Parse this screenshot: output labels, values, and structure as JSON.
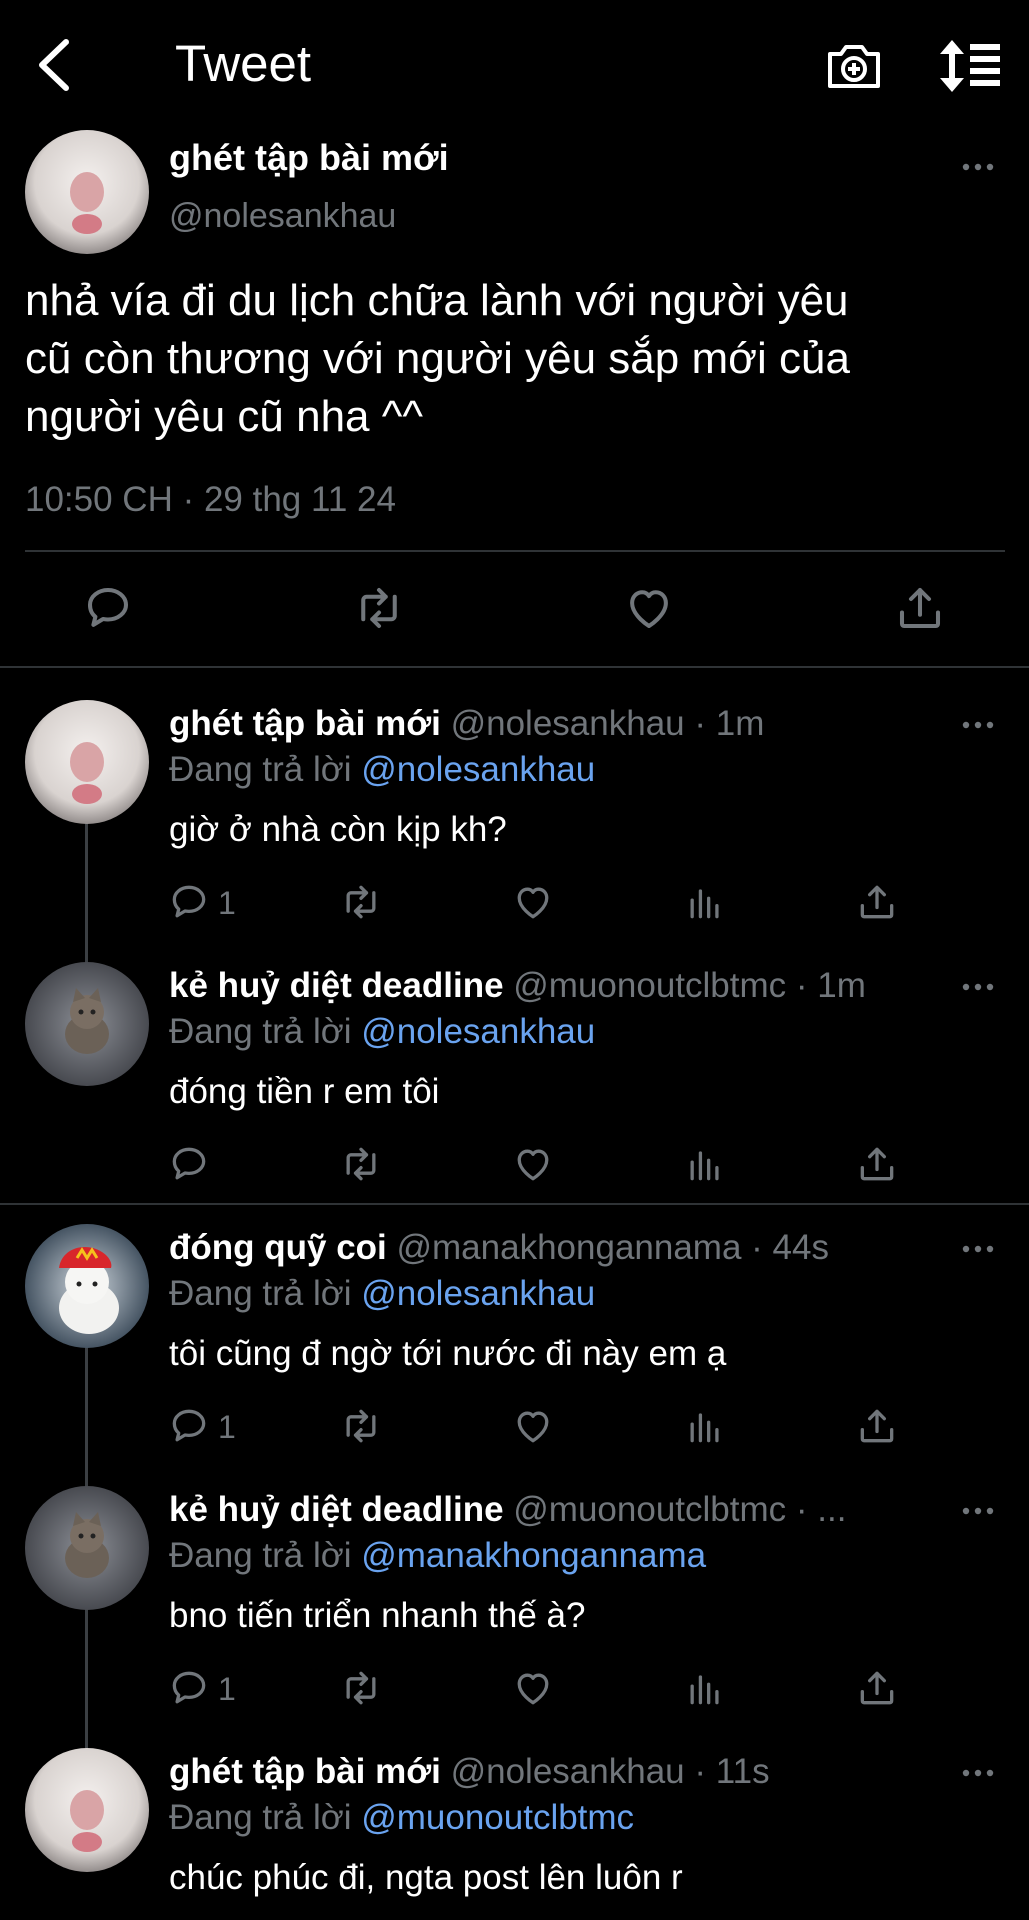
{
  "header": {
    "title": "Tweet",
    "icons": [
      "back-arrow-icon",
      "camera-plus-icon",
      "sort-icon"
    ]
  },
  "main_tweet": {
    "author_name": "ghét tập bài mới",
    "author_handle": "@nolesankhau",
    "text": "nhả vía đi du lịch chữa lành với người yêu\ncũ còn thương với người yêu sắp mới của\nngười yêu cũ nha ^^",
    "timestamp": "10:50 CH · 29 thg 11 24"
  },
  "replies": [
    {
      "name": "ghét tập bài mới",
      "handle": "@nolesankhau",
      "time": "· 1m",
      "replying_prefix": "Đang trả lời",
      "replying_to": "@nolesankhau",
      "text": " giờ ở nhà còn kịp kh?",
      "reply_count": "1"
    },
    {
      "name": "kẻ huỷ diệt deadline",
      "handle": "@muonoutclbtmc",
      "time": "· 1m",
      "replying_prefix": "Đang trả lời",
      "replying_to": "@nolesankhau",
      "text": "đóng tiền r em tôi",
      "reply_count": ""
    },
    {
      "name": "đóng quỹ coi",
      "handle": "@manakhongannama",
      "time": "· 44s",
      "replying_prefix": "Đang trả lời",
      "replying_to": "@nolesankhau",
      "text": "tôi cũng đ ngờ tới nước đi này em ạ",
      "reply_count": "1"
    },
    {
      "name": "kẻ huỷ diệt deadline",
      "handle": "@muonoutclbtmc",
      "time": "· ...",
      "replying_prefix": "Đang trả lời",
      "replying_to": "@manakhongannama",
      "text": "bno tiến triển nhanh thế à?",
      "reply_count": "1"
    },
    {
      "name": "ghét tập bài mới",
      "handle": "@nolesankhau",
      "time": "· 11s",
      "replying_prefix": "Đang trả lời",
      "replying_to": "@muonoutclbtmc",
      "text": "chúc phúc đi, ngta post lên luôn r",
      "reply_count": ""
    }
  ],
  "colors": {
    "background": "#000000",
    "text": "#e7e9ea",
    "muted": "#71767b",
    "mention": "#6aa3ef",
    "divider": "#2f3336"
  }
}
